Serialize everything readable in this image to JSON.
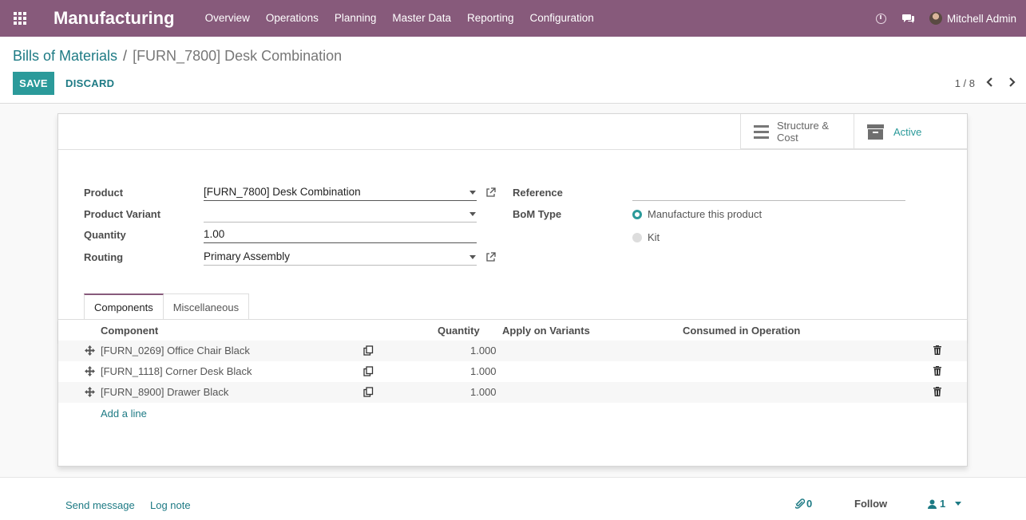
{
  "navbar": {
    "app_name": "Manufacturing",
    "menu": [
      "Overview",
      "Operations",
      "Planning",
      "Master Data",
      "Reporting",
      "Configuration"
    ],
    "user_name": "Mitchell Admin"
  },
  "control_panel": {
    "breadcrumb_parent": "Bills of Materials",
    "breadcrumb_separator": "/",
    "breadcrumb_current": "[FURN_7800] Desk Combination",
    "save_label": "SAVE",
    "discard_label": "DISCARD",
    "pager": "1 / 8"
  },
  "button_box": {
    "structure_cost_line1": "Structure &",
    "structure_cost_line2": "Cost",
    "active_label": "Active"
  },
  "form": {
    "product_label": "Product",
    "product_value": "[FURN_7800] Desk Combination",
    "variant_label": "Product Variant",
    "variant_value": "",
    "quantity_label": "Quantity",
    "quantity_value": "1.00",
    "routing_label": "Routing",
    "routing_value": "Primary Assembly",
    "reference_label": "Reference",
    "reference_value": "",
    "bom_type_label": "BoM Type",
    "bom_type_options": [
      "Manufacture this product",
      "Kit"
    ],
    "bom_type_selected": "Manufacture this product"
  },
  "tabs": [
    "Components",
    "Miscellaneous"
  ],
  "table": {
    "headers": {
      "component": "Component",
      "quantity": "Quantity",
      "variants": "Apply on Variants",
      "operation": "Consumed in Operation"
    },
    "rows": [
      {
        "component": "[FURN_0269] Office Chair Black",
        "quantity": "1.000"
      },
      {
        "component": "[FURN_1118] Corner Desk Black",
        "quantity": "1.000"
      },
      {
        "component": "[FURN_8900] Drawer Black",
        "quantity": "1.000"
      }
    ],
    "add_line": "Add a line"
  },
  "chatter": {
    "send_message": "Send message",
    "log_note": "Log note",
    "attachments_count": "0",
    "follow": "Follow",
    "followers_count": "1"
  },
  "colors": {
    "navbar": "#875a7b",
    "primary": "#2b9a9a",
    "link": "#1d7a84"
  }
}
